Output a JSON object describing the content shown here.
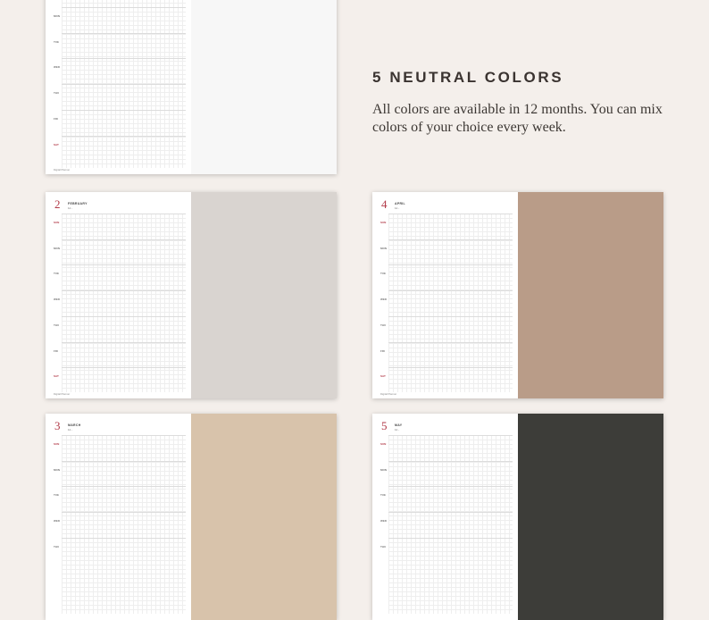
{
  "info": {
    "heading": "5 NEUTRAL COLORS",
    "description": "All colors are available in 12 months. You can mix colors of your choice every week."
  },
  "planners": [
    {
      "id": "white",
      "month_number": "",
      "month_name": "",
      "sub": "",
      "color": "#f7f7f7",
      "days": [
        "MON",
        "TUE",
        "WED",
        "THU",
        "FRI",
        "SAT"
      ],
      "footer": "Digital Planner"
    },
    {
      "id": "grey",
      "month_number": "2",
      "month_name": "FEBRUARY",
      "sub": "11 -",
      "color": "#d9d4d0",
      "days": [
        "SUN",
        "MON",
        "TUE",
        "WED",
        "THU",
        "FRI",
        "SAT"
      ],
      "footer": "Digital Planner"
    },
    {
      "id": "tan",
      "month_number": "4",
      "month_name": "APRIL",
      "sub": "11 -",
      "color": "#b99c88",
      "days": [
        "SUN",
        "MON",
        "TUE",
        "WED",
        "THU",
        "FRI",
        "SAT"
      ],
      "footer": "Digital Planner"
    },
    {
      "id": "beige",
      "month_number": "3",
      "month_name": "MARCH",
      "sub": "11 -",
      "color": "#d8c3ab",
      "days": [
        "SUN",
        "MON",
        "TUE",
        "WED",
        "THU"
      ],
      "footer": ""
    },
    {
      "id": "charcoal",
      "month_number": "5",
      "month_name": "MAY",
      "sub": "11 -",
      "color": "#3d3d39",
      "days": [
        "SUN",
        "MON",
        "TUE",
        "WED",
        "THU"
      ],
      "footer": ""
    }
  ]
}
